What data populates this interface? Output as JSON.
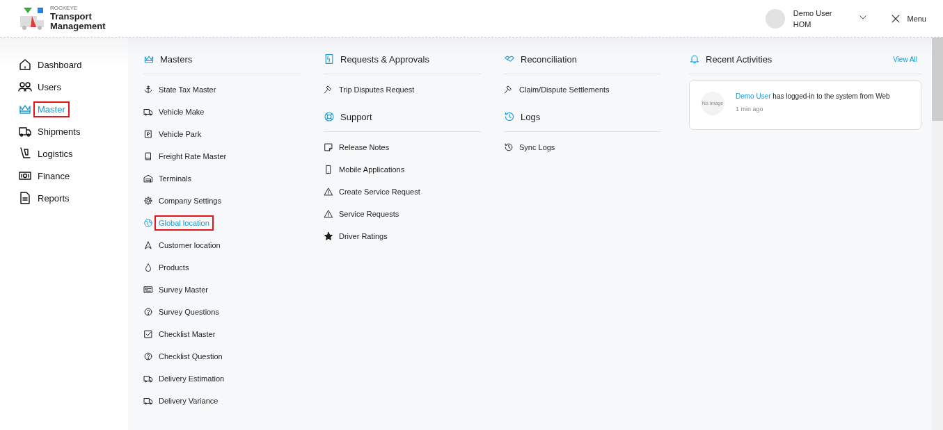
{
  "header": {
    "brand_small": "ROCKEYE",
    "brand_title": "Transport",
    "brand_subtitle": "Management",
    "user_name": "Demo User",
    "user_role": "HOM",
    "menu_label": "Menu"
  },
  "sidebar": {
    "items": [
      {
        "label": "Dashboard",
        "selected": false,
        "highlighted": false
      },
      {
        "label": "Users",
        "selected": false,
        "highlighted": false
      },
      {
        "label": "Master",
        "selected": true,
        "highlighted": true
      },
      {
        "label": "Shipments",
        "selected": false,
        "highlighted": false
      },
      {
        "label": "Logistics",
        "selected": false,
        "highlighted": false
      },
      {
        "label": "Finance",
        "selected": false,
        "highlighted": false
      },
      {
        "label": "Reports",
        "selected": false,
        "highlighted": false
      }
    ]
  },
  "columns": [
    {
      "sections": [
        {
          "title": "Masters",
          "items": [
            {
              "label": "State Tax Master",
              "selected": false,
              "highlighted": false
            },
            {
              "label": "Vehicle Make",
              "selected": false,
              "highlighted": false
            },
            {
              "label": "Vehicle Park",
              "selected": false,
              "highlighted": false
            },
            {
              "label": "Freight Rate Master",
              "selected": false,
              "highlighted": false
            },
            {
              "label": "Terminals",
              "selected": false,
              "highlighted": false
            },
            {
              "label": "Company Settings",
              "selected": false,
              "highlighted": false
            },
            {
              "label": "Global location",
              "selected": true,
              "highlighted": true
            },
            {
              "label": "Customer location",
              "selected": false,
              "highlighted": false
            },
            {
              "label": "Products",
              "selected": false,
              "highlighted": false
            },
            {
              "label": "Survey Master",
              "selected": false,
              "highlighted": false
            },
            {
              "label": "Survey Questions",
              "selected": false,
              "highlighted": false
            },
            {
              "label": "Checklist Master",
              "selected": false,
              "highlighted": false
            },
            {
              "label": "Checklist Question",
              "selected": false,
              "highlighted": false
            },
            {
              "label": "Delivery Estimation",
              "selected": false,
              "highlighted": false
            },
            {
              "label": "Delivery Variance",
              "selected": false,
              "highlighted": false
            }
          ]
        }
      ]
    },
    {
      "sections": [
        {
          "title": "Requests & Approvals",
          "items": [
            {
              "label": "Trip Disputes Request",
              "selected": false,
              "highlighted": false
            }
          ]
        },
        {
          "title": "Support",
          "items": [
            {
              "label": "Release Notes",
              "selected": false,
              "highlighted": false
            },
            {
              "label": "Mobile Applications",
              "selected": false,
              "highlighted": false
            },
            {
              "label": "Create Service Request",
              "selected": false,
              "highlighted": false
            },
            {
              "label": "Service Requests",
              "selected": false,
              "highlighted": false
            },
            {
              "label": "Driver Ratings",
              "selected": false,
              "highlighted": false
            }
          ]
        }
      ]
    },
    {
      "sections": [
        {
          "title": "Reconciliation",
          "items": [
            {
              "label": "Claim/Dispute Settlements",
              "selected": false,
              "highlighted": false
            }
          ]
        },
        {
          "title": "Logs",
          "items": [
            {
              "label": "Sync Logs",
              "selected": false,
              "highlighted": false
            }
          ]
        }
      ]
    }
  ],
  "recent_activities": {
    "title": "Recent Activities",
    "view_all": "View All",
    "activities": [
      {
        "avatar_text": "No Image",
        "user": "Demo User",
        "message": "has logged-in to the system from Web",
        "time": "1 min ago"
      }
    ]
  }
}
